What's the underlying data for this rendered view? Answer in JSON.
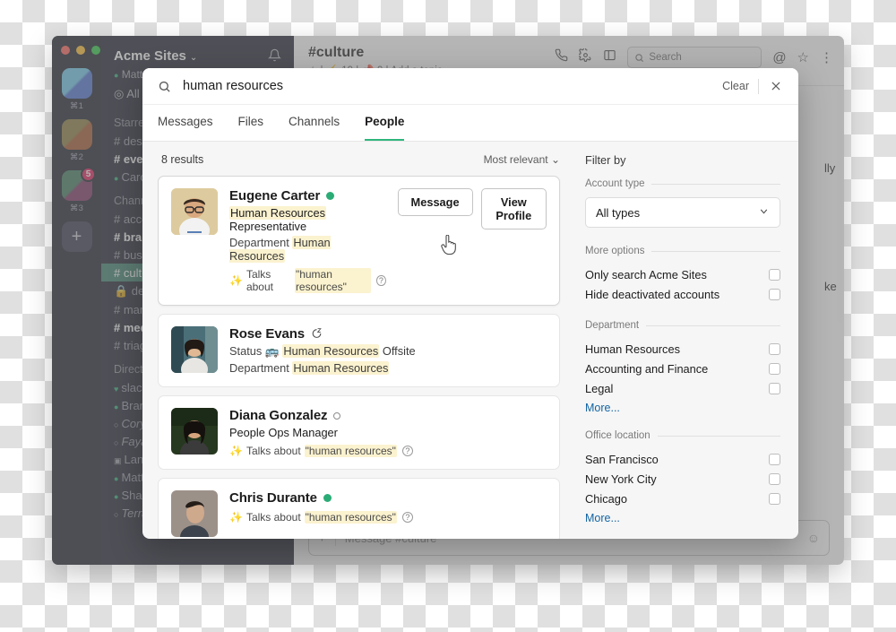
{
  "app": {
    "workspace_name": "Acme Sites",
    "workspace_caret": "⌄",
    "current_user": "Matt Kump",
    "bell_icon": "🔔",
    "all_threads": "All Threads",
    "team_shortcuts": [
      "⌘1",
      "⌘2",
      "⌘3"
    ],
    "team_badge": "5",
    "add_workspace": "+",
    "sections": [
      {
        "title": "Starred",
        "items": [
          {
            "label": "# design-team",
            "style": "normal"
          },
          {
            "label": "# events",
            "style": "bold"
          },
          {
            "label": "Carolyn Kim",
            "style": "presence-online"
          }
        ]
      },
      {
        "title": "Channels",
        "items": [
          {
            "label": "# accounting",
            "style": "normal"
          },
          {
            "label": "# brainstorm",
            "style": "bold"
          },
          {
            "label": "# business",
            "style": "normal"
          },
          {
            "label": "# culture",
            "style": "active"
          },
          {
            "label": "🔒 design-crit",
            "style": "normal"
          },
          {
            "label": "# marketing",
            "style": "normal"
          },
          {
            "label": "# media",
            "style": "bold"
          },
          {
            "label": "# triage",
            "style": "normal"
          }
        ]
      },
      {
        "title": "Direct Messages",
        "items": [
          {
            "label": "slackbot",
            "style": "heart"
          },
          {
            "label": "Brandon Vu",
            "style": "presence-online"
          },
          {
            "label": "Cory Lee",
            "style": "presence-offline-italic"
          },
          {
            "label": "Fayaz Ahmed",
            "style": "presence-offline-italic"
          },
          {
            "label": "Lane, Ana",
            "style": "multi"
          },
          {
            "label": "Matt Kump",
            "style": "presence-online"
          },
          {
            "label": "Shanice B",
            "style": "presence-online"
          },
          {
            "label": "Terra Lee",
            "style": "presence-offline-italic"
          }
        ]
      }
    ],
    "channel": {
      "title": "#culture",
      "meta": "☆ | ⚡ 19 | 📌 0 | Add a topic",
      "call_icon": "phone-icon",
      "settings_icon": "gear-icon",
      "panel_icon": "panel-icon",
      "search_placeholder": "Search",
      "mentions_icon": "@",
      "star_icon": "☆",
      "more_icon": "⋮"
    },
    "composer_placeholder": "Message #culture",
    "background_fragments": [
      "lly",
      "ke"
    ]
  },
  "search": {
    "query": "human resources",
    "search_icon": "search-icon",
    "clear_label": "Clear",
    "close_icon": "×",
    "tabs": [
      {
        "label": "Messages",
        "active": false
      },
      {
        "label": "Files",
        "active": false
      },
      {
        "label": "Channels",
        "active": false
      },
      {
        "label": "People",
        "active": true
      }
    ],
    "results_count": "8 results",
    "sort_label": "Most relevant",
    "sort_caret": "⌄",
    "talks_prefix": "Talks about",
    "highlight_color": "#fbf2cf",
    "accent_color": "#2eb67d",
    "link_color": "#1264a3",
    "results": [
      {
        "name": "Eugene Carter",
        "presence": "online",
        "title_pre": "",
        "title_mark": "Human Resources",
        "title_post": " Representative",
        "dept_label": "Department",
        "dept_value": "Human Resources",
        "talks_quote": "\"human resources\"",
        "actions": [
          "Message",
          "View Profile"
        ],
        "avatar_colors": [
          "#d6c08a",
          "#e8dcc0"
        ]
      },
      {
        "name": "Rose Evans",
        "presence": "away",
        "status_label": "Status",
        "status_emoji": "🚌",
        "status_mark": "Human Resources",
        "status_post": " Offsite",
        "dept_label": "Department",
        "dept_value": "Human Resources",
        "avatar_colors": [
          "#6d8a92",
          "#2e4a52"
        ]
      },
      {
        "name": "Diana Gonzalez",
        "presence": "offline",
        "title_plain": "People Ops Manager",
        "talks_quote": "\"human resources\"",
        "avatar_colors": [
          "#2c3f2c",
          "#1d2a1d"
        ]
      },
      {
        "name": "Chris Durante",
        "presence": "online",
        "talks_quote": "\"human resources\"",
        "avatar_colors": [
          "#9c9189",
          "#6b625c"
        ]
      }
    ],
    "filters": {
      "title": "Filter by",
      "account_type": {
        "section_label": "Account type",
        "value": "All types",
        "caret": "⌄"
      },
      "more_options": {
        "section_label": "More options",
        "items": [
          "Only search Acme Sites",
          "Hide deactivated accounts"
        ]
      },
      "department": {
        "section_label": "Department",
        "items": [
          "Human Resources",
          "Accounting and Finance",
          "Legal"
        ],
        "more_label": "More..."
      },
      "office_location": {
        "section_label": "Office location",
        "items": [
          "San Francisco",
          "New York City",
          "Chicago"
        ],
        "more_label": "More..."
      }
    }
  }
}
